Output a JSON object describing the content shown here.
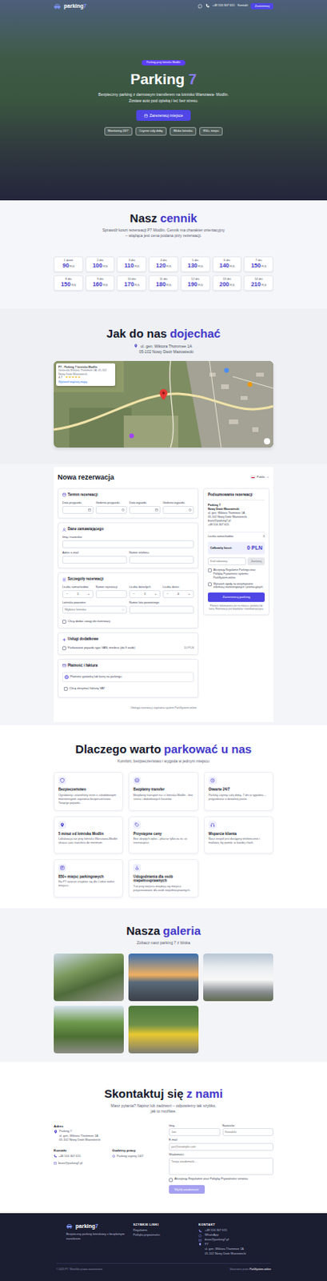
{
  "nav": {
    "logo": "parking",
    "logo_accent": "7",
    "phone": "+48 516 307 615",
    "link": "Kontakt",
    "cta": "Zarezerwuj"
  },
  "hero": {
    "badge": "Parking przy lotnisku Modlin",
    "title": "Parking",
    "title_accent": "7",
    "subtitle": "Bezpieczny parking z darmowym transferem na lotnisko Warszawa- Modlin. Zostaw auto pod opieką i leć bez stresu.",
    "button": "Zarezerwuj miejsce",
    "chips": [
      "Monitoring 24/7",
      "Czynne cały dobę",
      "Blisko lotniska",
      "850+ miejsc"
    ]
  },
  "pricing": {
    "title": "Nasz",
    "title_accent": "cennik",
    "subtitle": "Sprawdź koszt rezerwacji P7 Modlin. Cennik ma charakter orientacyjny – wiążąca jest cena podana przy rezerwacji.",
    "items": [
      {
        "days": "1 dzień",
        "price": "90",
        "unit": "PLN"
      },
      {
        "days": "2 dni",
        "price": "100",
        "unit": "PLN"
      },
      {
        "days": "3 dni",
        "price": "110",
        "unit": "PLN"
      },
      {
        "days": "4 dni",
        "price": "120",
        "unit": "PLN"
      },
      {
        "days": "5 dni",
        "price": "130",
        "unit": "PLN"
      },
      {
        "days": "6 dni",
        "price": "140",
        "unit": "PLN"
      },
      {
        "days": "7 dni",
        "price": "150",
        "unit": "PLN"
      },
      {
        "days": "8 dni",
        "price": "150",
        "unit": "PLN"
      },
      {
        "days": "9 dni",
        "price": "160",
        "unit": "PLN"
      },
      {
        "days": "10 dni",
        "price": "170",
        "unit": "PLN"
      },
      {
        "days": "11 dni",
        "price": "180",
        "unit": "PLN"
      },
      {
        "days": "12 dni",
        "price": "190",
        "unit": "PLN"
      },
      {
        "days": "13 dni",
        "price": "200",
        "unit": "PLN"
      },
      {
        "days": "14 dni",
        "price": "210",
        "unit": "PLN"
      }
    ]
  },
  "map": {
    "title": "Jak do nas",
    "title_accent": "dojechać",
    "address": [
      "ul. gen. Wiktora Thommee 1A",
      "05-102 Nowy Dwór Mazowiecki"
    ],
    "place": {
      "name": "P7 - Parking 7 lotnisko Modlin",
      "address": "Generała Wiktora Thommée 1A, 05-102 Nowy Dwór Mazowiecki",
      "rating": "4,7",
      "star": "★",
      "stars": 5,
      "link": "Wyświetl większą mapę"
    }
  },
  "reservation": {
    "title": "Nowa rezerwacja",
    "language": "Polski",
    "term": {
      "title": "Termin rezerwacji",
      "fields": [
        "Data przyjazdu",
        "Godzina przyjazdu",
        "Data wyjazdu",
        "Godzina wyjazdu"
      ]
    },
    "customer": {
      "title": "Dane zamawiającego",
      "name": "Imię i nazwisko",
      "email": "Adres e-mail",
      "phone": "Numer telefonu"
    },
    "details": {
      "title": "Szczegóły rezerwacji",
      "minus": "−",
      "plus": "+",
      "counters": [
        {
          "label": "Liczba samochodów",
          "kind": "stepper",
          "value": "1"
        },
        {
          "label": "Numer rejestracji",
          "kind": "input"
        },
        {
          "label": "Liczba dorosłych",
          "kind": "stepper",
          "value": "1"
        },
        {
          "label": "Liczba dzieci",
          "kind": "stepper",
          "value": "0"
        }
      ],
      "airport": "Lotnisko powrotne",
      "airport_placeholder": "Wybierz lotnisko",
      "flight": "Numer lotu powrotnego",
      "notes": {
        "label": "Chcę dodać uwagi do rezerwacji",
        "checked": false
      }
    },
    "extras": {
      "title": "Usługi dodatkowe",
      "items": [
        {
          "label": "Parkowanie pojazdu typu VAN, minibus (do 9 osób)",
          "price": "10 PLN",
          "checked": false
        }
      ]
    },
    "payment": {
      "title": "Płatność i faktura",
      "options": [
        {
          "label": "Płatność gotówką lub kartą na parkingu",
          "selected": true
        }
      ],
      "invoice": {
        "label": "Chcę otrzymać fakturę VAT",
        "checked": false
      }
    },
    "footnote": "Obsługa rezerwacji zapewnia system ParkSystem.online",
    "summary": {
      "title": "Podsumowanie rezerwacji",
      "name": "Parking 7",
      "lines": [
        "Nowy Dwór Mazowiecki",
        "ul. gen. Wiktora Thommee 1A",
        "05-102 Nowy Dwór Mazowiecki",
        "biuro@parking7.pl",
        "+48 516 307 615"
      ],
      "cars_label": "Liczba samochodów",
      "cars": "1",
      "total_label": "Całkowity koszt:",
      "total": "0 PLN",
      "coupon_placeholder": "Kod rabatowy",
      "coupon_button": "Zastosuj",
      "consents": [
        {
          "label": "Akceptuję Regulamin Parkingu oraz Politykę Prywatności systemu ParkSystem.online",
          "checked": false
        },
        {
          "label": "Wyrażam zgodę na otrzymywanie informacji marketingowych i promocyjnych",
          "checked": false
        }
      ],
      "button": "Zarezerwuj parking",
      "note": "Płatność dokonywana jest na miejscu, gotówką lub kartą. Rezerwacja jest bezpłatna i niezobowiązująca."
    }
  },
  "features": {
    "title": "Dlaczego warto",
    "title_accent": "parkować u nas",
    "subtitle": "Komfort, bezpieczeństwo i wygoda w jednym miejscu",
    "items": [
      {
        "title": "Bezpieczeństwo",
        "text": "Ogrodzony i oświetlony teren z całodobowym monitoringiem zapewnia bezpieczeństwo Twojego pojazdu."
      },
      {
        "title": "Bezpłatny transfer",
        "text": "Bezpłatny transport na i z lotniska Modlin - bez stresu i dodatkowych kosztów."
      },
      {
        "title": "Otwarte 24/7",
        "text": "Parking czynny całą dobę, 7 dni w tygodniu – przyjedziesz o dowolnej porze."
      },
      {
        "title": "5 minut od lotniska Modlin",
        "text": "Lokalizacja tuż przy lotnisku Warszawa-Modlin skraca czas transferu do minimum."
      },
      {
        "title": "Przystępne ceny",
        "text": "Bez ukrytych opłat – płacisz tylko za to, co rezerwujesz."
      },
      {
        "title": "Wsparcie klienta",
        "text": "Nasz zespół jest dostępny telefonicznie i mailowo, by pomóc w każdej chwili."
      },
      {
        "title": "850+ miejsc parkingowych",
        "text": "Na P7 zawsze znajdzie się dla Ciebie wolne miejsce."
      },
      {
        "title": "Udogodnienia dla osób niepełnosprawnych",
        "text": "Tuż przy wejściu znajdują się miejsca przystosowane dla osób niepełnosprawnych."
      }
    ]
  },
  "gallery": {
    "title": "Nasza",
    "title_accent": "galeria",
    "subtitle": "Zobacz nasz parking 7 z bliska"
  },
  "contact": {
    "title": "Skontaktuj się",
    "title_accent": "z nami",
    "subtitle": "Masz pytania? Napisz lub zadzwoń – odpowiemy tak szybko, jak to możliwe.",
    "address_title": "Adres",
    "address": [
      "Parking 7",
      "ul. gen. Wiktora Thommee 1A",
      "05-102 Nowy Dwór Mazowiecki"
    ],
    "contact_title": "Kontakt",
    "phone": "+48 516 307 615",
    "email": "biuro@parking7.pl",
    "hours_title": "Godziny pracy",
    "hours": "Parking czynny 24/7",
    "form": {
      "first": "Imię",
      "first_ph": "Jan",
      "last": "Nazwisko",
      "last_ph": "Kowalski",
      "email": "E-mail",
      "email_ph": "jan@example.com",
      "message": "Wiadomość",
      "message_ph": "Twoja wiadomość...",
      "consent": "Akceptuję Regulamin oraz Politykę Prywatności serwisu.",
      "consent_checked": false,
      "button": "Wyślij wiadomość",
      "button_disabled": true
    }
  },
  "footer": {
    "logo": "parking",
    "logo_accent": "7",
    "tagline": "Bezpieczny parking lotniskowy z bezpłatnym transferem.",
    "links_title": "SZYBKIE LINKI",
    "links": [
      "Regulamin",
      "Polityka prywatności"
    ],
    "contact_title": "KONTAKT",
    "contact": [
      "+48 516 307 615",
      "WhatsApp",
      "biuro@parking7.pl"
    ],
    "address": [
      "P7",
      "ul. gen. Wiktora Thommee 1A",
      "05-102 Nowy Dwór Mazowiecki"
    ],
    "copyright": "© 2025 P7. Wszelkie prawa zastrzeżone.",
    "credit_label": "Stworzone przez",
    "credit": "ParkSystem.online"
  }
}
